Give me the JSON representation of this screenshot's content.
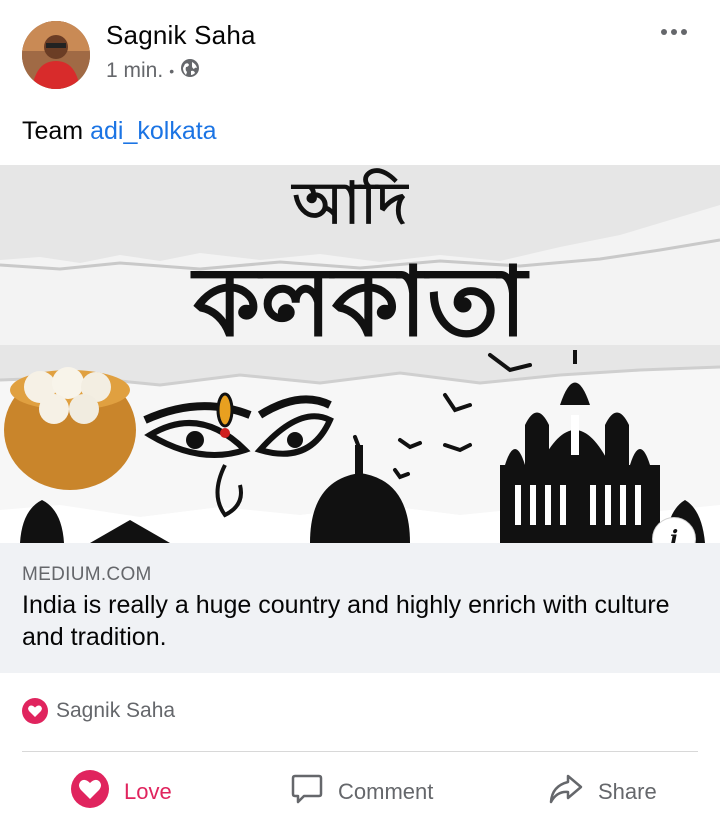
{
  "post": {
    "author": "Sagnik Saha",
    "timestamp": "1 min.",
    "visibility_icon": "globe-icon",
    "text_prefix": "Team ",
    "mention": "adi_kolkata",
    "colors": {
      "mention": "#1b74e4",
      "love": "#e0245e"
    }
  },
  "link_preview": {
    "image_caption": "আদি কলকাতা",
    "image_caption_top": "আদি",
    "image_caption_main": "কলকাতা",
    "domain": "MEDIUM.COM",
    "title": "India is really a huge country and highly enrich with culture and tradition."
  },
  "reactions": {
    "icon": "love-reaction-icon",
    "names": "Sagnik Saha"
  },
  "actions": {
    "love": "Love",
    "comment": "Comment",
    "share": "Share"
  }
}
